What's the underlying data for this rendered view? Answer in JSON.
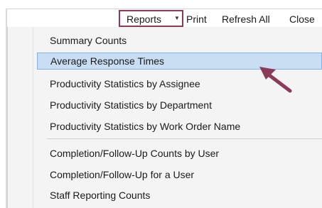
{
  "toolbar": {
    "reports_label": "Reports",
    "print_label": "Print",
    "refresh_all_label": "Refresh All",
    "close_label": "Close"
  },
  "menu": {
    "items": [
      {
        "label": "Summary Counts"
      },
      {
        "label": "Average Response Times",
        "highlighted": true
      },
      {
        "label": "Productivity Statistics by Assignee"
      },
      {
        "label": "Productivity Statistics by Department"
      },
      {
        "label": "Productivity Statistics by Work Order Name"
      },
      {
        "label": "Completion/Follow-Up Counts by User"
      },
      {
        "label": "Completion/Follow-Up for a User"
      },
      {
        "label": "Staff Reporting Counts"
      }
    ]
  },
  "colors": {
    "highlight_fill": "#c9def3",
    "highlight_border": "#7eb4e8",
    "annotation": "#8b3a5a"
  }
}
